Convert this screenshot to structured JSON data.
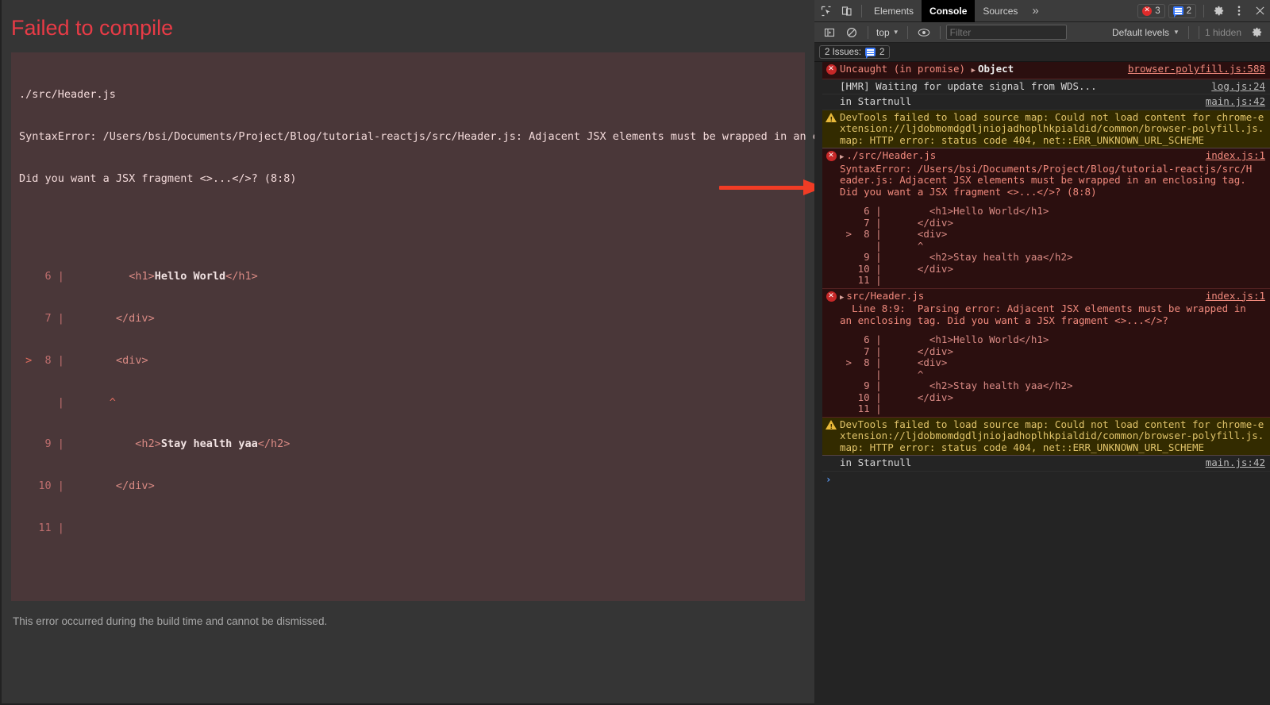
{
  "overlay": {
    "title": "Failed to compile",
    "file": "./src/Header.js",
    "error_line1": "SyntaxError: /Users/bsi/Documents/Project/Blog/tutorial-reactjs/src/Header.js: Adjacent JSX elements must be wrapped in an enclosing tag.",
    "error_line2": "Did you want a JSX fragment <>...</>? (8:8)",
    "code_lines": [
      {
        "marker": "",
        "num": "6",
        "bar": "|",
        "code": "        <h1>Hello World</h1>"
      },
      {
        "marker": "",
        "num": "7",
        "bar": "|",
        "code": "      </div>"
      },
      {
        "marker": ">",
        "num": "8",
        "bar": "|",
        "code": "      <div>"
      },
      {
        "marker": "",
        "num": "",
        "bar": "|",
        "code": "      ^"
      },
      {
        "marker": "",
        "num": "9",
        "bar": "|",
        "code": "        <h2>Stay health yaa</h2>"
      },
      {
        "marker": "",
        "num": "10",
        "bar": "|",
        "code": "      </div>"
      },
      {
        "marker": "",
        "num": "11",
        "bar": "|",
        "code": ""
      }
    ],
    "footer": "This error occurred during the build time and cannot be dismissed.",
    "annotation_arrow": "red-right-arrow",
    "accent_color": "#e83b46",
    "arrow_color": "#f03c25"
  },
  "devtools": {
    "tabs": [
      {
        "label": "Elements",
        "selected": false
      },
      {
        "label": "Console",
        "selected": true
      },
      {
        "label": "Sources",
        "selected": false
      }
    ],
    "more_tabs_label": "»",
    "error_count": "3",
    "message_count": "2",
    "icons": {
      "inspect": "inspect-element-icon",
      "device": "device-toolbar-icon",
      "settings": "gear-icon",
      "kebab": "more-options-icon",
      "close": "close-icon",
      "sidebar": "console-sidebar-icon",
      "clear": "clear-console-icon",
      "eye": "live-expression-icon"
    },
    "filterbar": {
      "context": "top",
      "filter_placeholder": "Filter",
      "filter_value": "",
      "levels": "Default levels",
      "hidden": "1 hidden"
    },
    "issues_bar": {
      "label": "2 Issues:",
      "count": "2"
    },
    "messages": [
      {
        "kind": "err",
        "icon": "error-circle-icon",
        "has_triangle": true,
        "text": "Uncaught (in promise) ",
        "object_label": "Object",
        "source": "browser-polyfill.js:588"
      },
      {
        "kind": "info",
        "icon": "",
        "has_triangle": false,
        "text": "[HMR] Waiting for update signal from WDS...",
        "source": "log.js:24"
      },
      {
        "kind": "info",
        "icon": "",
        "has_triangle": false,
        "text": "in Startnull",
        "source": "main.js:42"
      },
      {
        "kind": "warn",
        "icon": "warning-triangle-icon",
        "has_triangle": false,
        "text": "DevTools failed to load source map: Could not load content for chrome-extension://ljdobmomdgdljniojadhoplhkpialdid/common/browser-polyfill.js.map: HTTP error: status code 404, net::ERR_UNKNOWN_URL_SCHEME",
        "source": ""
      },
      {
        "kind": "err",
        "icon": "error-circle-icon",
        "has_triangle": true,
        "text": "./src/Header.js",
        "detail": "SyntaxError: /Users/bsi/Documents/Project/Blog/tutorial-reactjs/src/Header.js: Adjacent JSX elements must be wrapped in an enclosing tag. Did you want a JSX fragment <>...</>? (8:8)",
        "code": "    6 |        <h1>Hello World</h1>\n    7 |      </div>\n >  8 |      <div>\n      |      ^\n    9 |        <h2>Stay health yaa</h2>\n   10 |      </div>\n   11 |",
        "source": "index.js:1"
      },
      {
        "kind": "err",
        "icon": "error-circle-icon",
        "has_triangle": true,
        "text": "src/Header.js",
        "detail": "  Line 8:9:  Parsing error: Adjacent JSX elements must be wrapped in an enclosing tag. Did you want a JSX fragment <>...</>?",
        "code": "    6 |        <h1>Hello World</h1>\n    7 |      </div>\n >  8 |      <div>\n      |      ^\n    9 |        <h2>Stay health yaa</h2>\n   10 |      </div>\n   11 |",
        "source": "index.js:1"
      },
      {
        "kind": "warn",
        "icon": "warning-triangle-icon",
        "has_triangle": false,
        "text": "DevTools failed to load source map: Could not load content for chrome-extension://ljdobmomdgdljniojadhoplhkpialdid/common/browser-polyfill.js.map: HTTP error: status code 404, net::ERR_UNKNOWN_URL_SCHEME",
        "source": ""
      },
      {
        "kind": "info",
        "icon": "",
        "has_triangle": false,
        "text": "in Startnull",
        "source": "main.js:42"
      }
    ],
    "prompt": {
      "chevron": "›",
      "value": ""
    }
  }
}
